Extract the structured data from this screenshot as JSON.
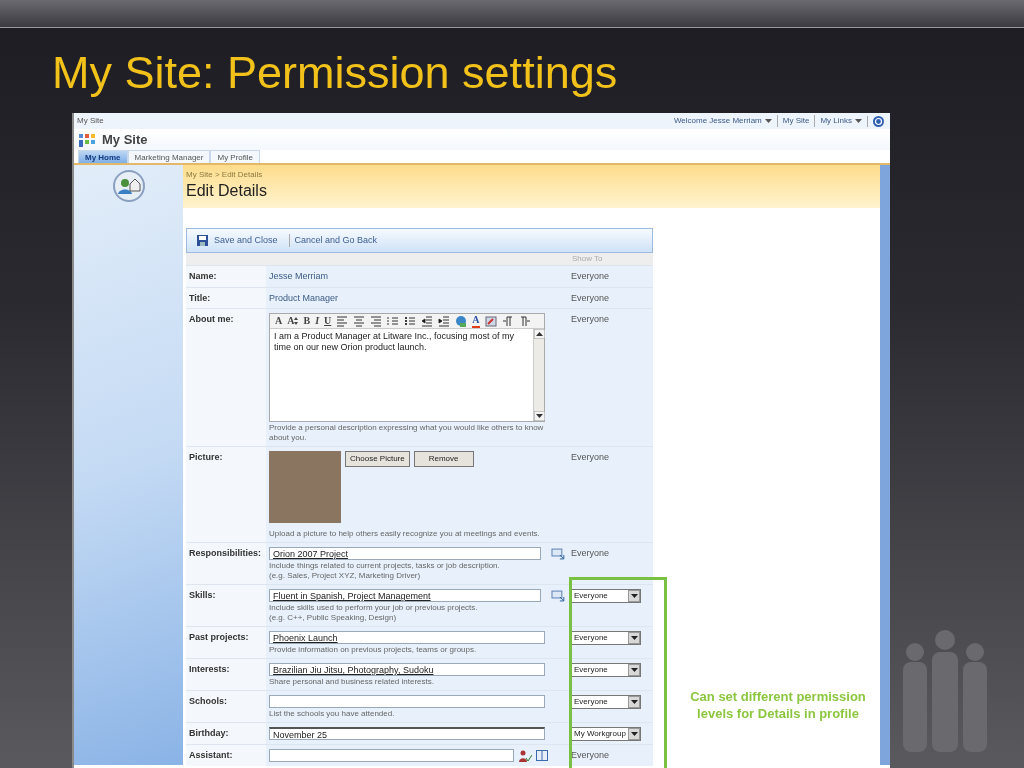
{
  "slide": {
    "title": "My Site: Permission settings"
  },
  "top_bar": {
    "site": "My Site",
    "links": [
      {
        "label": "Welcome Jesse Merriam",
        "menu": true
      },
      {
        "label": "My Site",
        "menu": false
      },
      {
        "label": "My Links",
        "menu": true
      }
    ]
  },
  "header": {
    "title": "My Site"
  },
  "tabs": [
    {
      "label": "My Home",
      "selected": true
    },
    {
      "label": "Marketing Manager",
      "selected": false
    },
    {
      "label": "My Profile",
      "selected": false
    }
  ],
  "breadcrumb": "My Site > Edit Details",
  "page_title": "Edit Details",
  "toolbar": [
    "Save and Close",
    "Cancel and Go Back"
  ],
  "show_to_header": "Show To",
  "fields": [
    {
      "kind": "static",
      "label": "Name:",
      "value": "Jesse Merriam",
      "show_to": "Everyone",
      "show_to_editable": false
    },
    {
      "kind": "static",
      "label": "Title:",
      "value": "Product Manager",
      "show_to": "Everyone",
      "show_to_editable": false
    },
    {
      "kind": "richtext",
      "label": "About me:",
      "editor_toolbar": [
        {
          "kind": "font",
          "label": "A"
        },
        {
          "kind": "size",
          "label": "A"
        },
        {
          "kind": "bold",
          "label": "B"
        },
        {
          "kind": "italic",
          "label": "I"
        },
        {
          "kind": "underline",
          "label": "U"
        },
        {
          "kind": "align-left"
        },
        {
          "kind": "align-center"
        },
        {
          "kind": "align-right"
        },
        {
          "kind": "numbered-list"
        },
        {
          "kind": "bullet-list"
        },
        {
          "kind": "outdent"
        },
        {
          "kind": "indent"
        },
        {
          "kind": "link"
        },
        {
          "kind": "color",
          "label": "A"
        },
        {
          "kind": "highlight"
        },
        {
          "kind": "ltr"
        },
        {
          "kind": "rtl"
        }
      ],
      "value": "I am a Product Manager at Litware Inc., focusing most of my time on our new Orion product launch.",
      "hint": "Provide a personal description expressing what you would like others to know about you.",
      "show_to": "Everyone",
      "show_to_editable": false
    },
    {
      "kind": "picture",
      "label": "Picture:",
      "buttons": [
        "Choose Picture",
        "Remove"
      ],
      "hint": "Upload a picture to help others easily recognize you at meetings and events.",
      "show_to": "Everyone",
      "show_to_editable": false
    },
    {
      "kind": "tags",
      "label": "Responsibilities:",
      "value": "Orion 2007 Project",
      "hint": "Include things related to current projects, tasks or job description.\n(e.g. Sales, Project XYZ, Marketing Driver)",
      "show_to": "Everyone",
      "show_to_editable": false
    },
    {
      "kind": "tags",
      "label": "Skills:",
      "value": "Fluent in Spanish, Project Management",
      "hint": "Include skills used to perform your job or previous projects.\n(e.g. C++, Public Speaking, Design)",
      "show_to": "Everyone",
      "show_to_editable": true
    },
    {
      "kind": "text",
      "label": "Past projects:",
      "value": "Phoenix Launch",
      "hint": "Provide information on previous projects, teams or groups.",
      "show_to": "Everyone",
      "show_to_editable": true
    },
    {
      "kind": "text",
      "label": "Interests:",
      "value": "Brazilian Jiu Jitsu, Photography, Sudoku",
      "hint": "Share personal and business related interests.",
      "show_to": "Everyone",
      "show_to_editable": true
    },
    {
      "kind": "text",
      "label": "Schools:",
      "hint": "List the schools you have attended.",
      "show_to": "Everyone",
      "show_to_editable": true
    },
    {
      "kind": "date",
      "label": "Birthday:",
      "value": "November 25",
      "show_to": "My Workgroup",
      "show_to_editable": true
    },
    {
      "kind": "people",
      "label": "Assistant:",
      "show_to": "Everyone",
      "show_to_editable": false
    }
  ],
  "callout": "Can set different permission levels for Details in profile"
}
